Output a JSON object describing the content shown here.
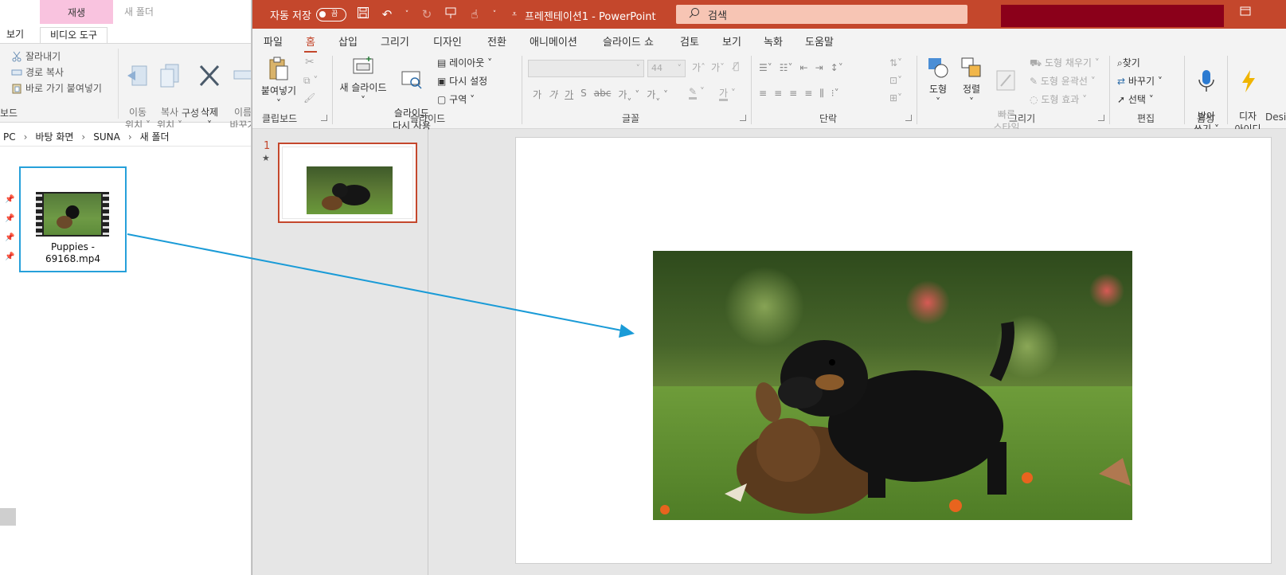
{
  "explorer": {
    "context_tab": "재생",
    "title": "새 폴더",
    "tabs": [
      "보기",
      "비디오 도구"
    ],
    "clipboard": {
      "cut": "잘라내기",
      "copy_path": "경로 복사",
      "paste_shortcut": "바로 가기 붙여넣기",
      "group_label": "보드"
    },
    "organize": {
      "move_to": "이동\n위치 ˅",
      "copy_to": "복사\n위치 ˅",
      "delete": "삭제\n˅",
      "rename": "이름\n바꾸기",
      "group_label": "구성"
    },
    "breadcrumbs": [
      "PC",
      "바탕 화면",
      "SUNA",
      "새 폴더"
    ],
    "file": {
      "name": "Puppies -\n69168.mp4"
    }
  },
  "ppt": {
    "autosave_label": "자동 저장",
    "autosave_state": "끔",
    "doc_title": "프레젠테이션1  -  PowerPoint",
    "search_placeholder": "검색",
    "tabs": [
      "파일",
      "홈",
      "삽입",
      "그리기",
      "디자인",
      "전환",
      "애니메이션",
      "슬라이드 쇼",
      "검토",
      "보기",
      "녹화",
      "도움말"
    ],
    "active_tab": "홈",
    "ribbon": {
      "clipboard": {
        "paste": "붙여넣기",
        "group": "클립보드"
      },
      "slides": {
        "new_slide": "새 슬라이드",
        "reuse": "슬라이드\n다시 사용",
        "layout": "레이아웃 ˅",
        "reset": "다시 설정",
        "section": "구역 ˅",
        "group": "슬라이드"
      },
      "font": {
        "size": "44",
        "group": "글꼴"
      },
      "paragraph": {
        "group": "단락"
      },
      "drawing": {
        "shapes": "도형",
        "arrange": "정렬",
        "quick_styles": "빠른\n스타일",
        "fill": "도형 채우기 ˅",
        "outline": "도형 윤곽선 ˅",
        "effects": "도형 효과 ˅",
        "group": "그리기"
      },
      "editing": {
        "find": "찾기",
        "replace": "바꾸기 ˅",
        "select": "선택 ˅",
        "group": "편집"
      },
      "voice": {
        "dictate": "받아\n쓰기 ˅",
        "group": "음성"
      },
      "designer": {
        "label": "디자\n아이디",
        "group": "Desig"
      }
    },
    "slide_number": "1",
    "slide_star": "★"
  },
  "colors": {
    "ppt_accent": "#c4472c",
    "explorer_selection": "#26a0da",
    "arrow": "#1a9bd7"
  }
}
